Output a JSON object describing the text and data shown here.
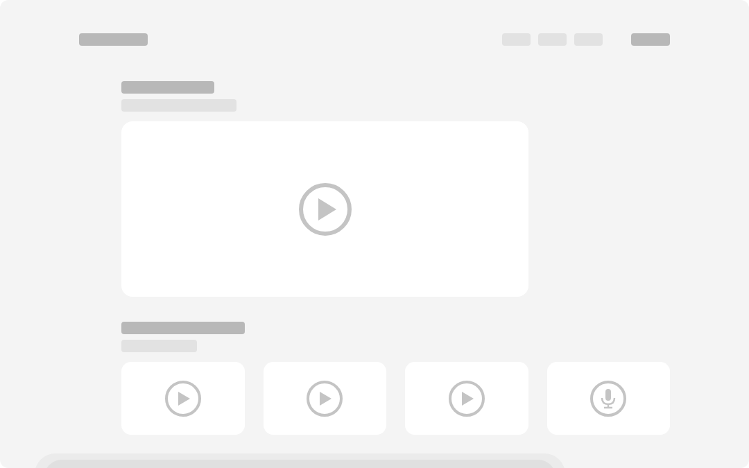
{
  "header": {
    "logo": {
      "kind": "bar"
    },
    "nav_links": [
      {
        "kind": "bar"
      },
      {
        "kind": "bar"
      },
      {
        "kind": "bar"
      }
    ],
    "action": {
      "kind": "bar"
    }
  },
  "featured": {
    "heading": {
      "kind": "bar"
    },
    "subheading": {
      "kind": "bar"
    },
    "media": {
      "kind": "video"
    }
  },
  "library": {
    "heading": {
      "kind": "bar"
    },
    "subheading": {
      "kind": "bar"
    },
    "cards": [
      {
        "kind": "video"
      },
      {
        "kind": "video"
      },
      {
        "kind": "video"
      },
      {
        "kind": "audio"
      }
    ]
  },
  "bottom_sheet": {
    "kind": "panel"
  }
}
